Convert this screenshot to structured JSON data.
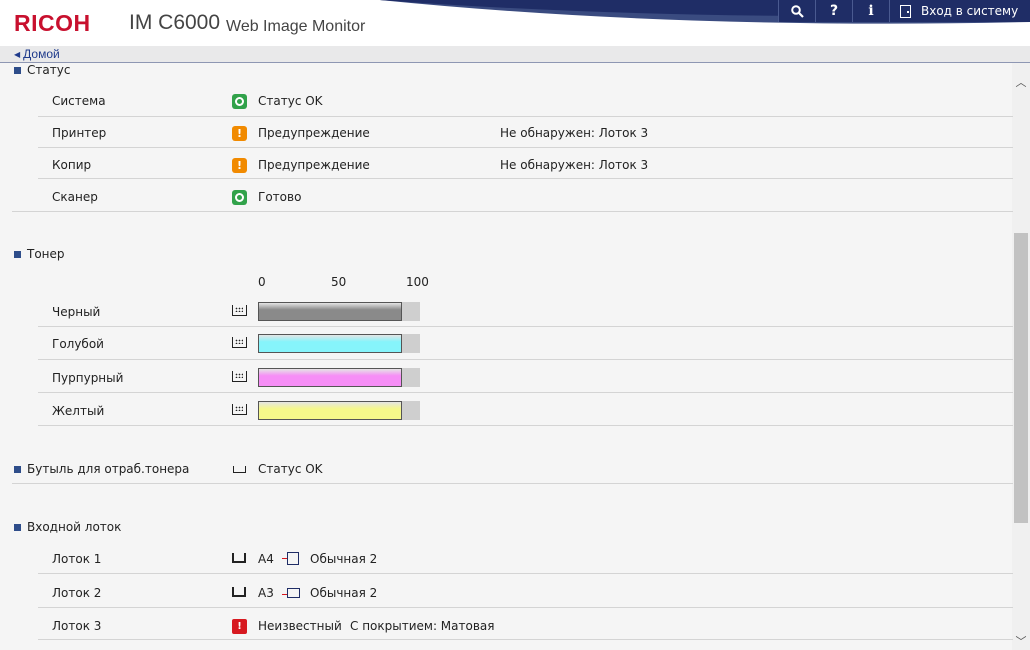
{
  "header": {
    "brand": "RICOH",
    "model": "IM C6000",
    "app_title": "Web Image Monitor",
    "login_label": "Вход в систему",
    "tools": [
      {
        "icon": "search-icon",
        "glyph": "🔍"
      },
      {
        "icon": "help-icon",
        "glyph": "?"
      },
      {
        "icon": "info-icon",
        "glyph": "i"
      }
    ]
  },
  "breadcrumb": {
    "home": "Домой"
  },
  "status": {
    "title": "Статус",
    "rows": [
      {
        "label": "Система",
        "state": "ok",
        "value": "Статус OK",
        "detail": ""
      },
      {
        "label": "Принтер",
        "state": "warning",
        "value": "Предупреждение",
        "detail": "Не обнаружен: Лоток 3"
      },
      {
        "label": "Копир",
        "state": "warning",
        "value": "Предупреждение",
        "detail": "Не обнаружен: Лоток 3"
      },
      {
        "label": "Сканер",
        "state": "ok",
        "value": "Готово",
        "detail": ""
      }
    ]
  },
  "toner": {
    "title": "Тонер",
    "scale": [
      "0",
      "50",
      "100"
    ],
    "levels": [
      {
        "label": "Черный",
        "percent": 90,
        "color": "#8a8a8a"
      },
      {
        "label": "Голубой",
        "percent": 90,
        "color": "#86f4fb"
      },
      {
        "label": "Пурпурный",
        "percent": 90,
        "color": "#f68ef6"
      },
      {
        "label": "Желтый",
        "percent": 90,
        "color": "#f5f88a"
      }
    ]
  },
  "waste_toner": {
    "label": "Бутыль для отраб.тонера",
    "value": "Статус OK"
  },
  "input_tray": {
    "title": "Входной лоток",
    "rows": [
      {
        "label": "Лоток 1",
        "state": "tray",
        "size": "A4",
        "orientation": "portrait",
        "paper": "Обычная 2"
      },
      {
        "label": "Лоток 2",
        "state": "tray",
        "size": "A3",
        "orientation": "landscape",
        "paper": "Обычная 2"
      },
      {
        "label": "Лоток 3",
        "state": "error",
        "size": "Неизвестный",
        "orientation": "",
        "paper": "С покрытием: Матовая"
      }
    ]
  },
  "colors": {
    "ok": "#31a24a",
    "warning": "#f18a00",
    "error": "#d71920",
    "toolbar": "#1f2d66",
    "bullet": "#2e4d8a"
  }
}
